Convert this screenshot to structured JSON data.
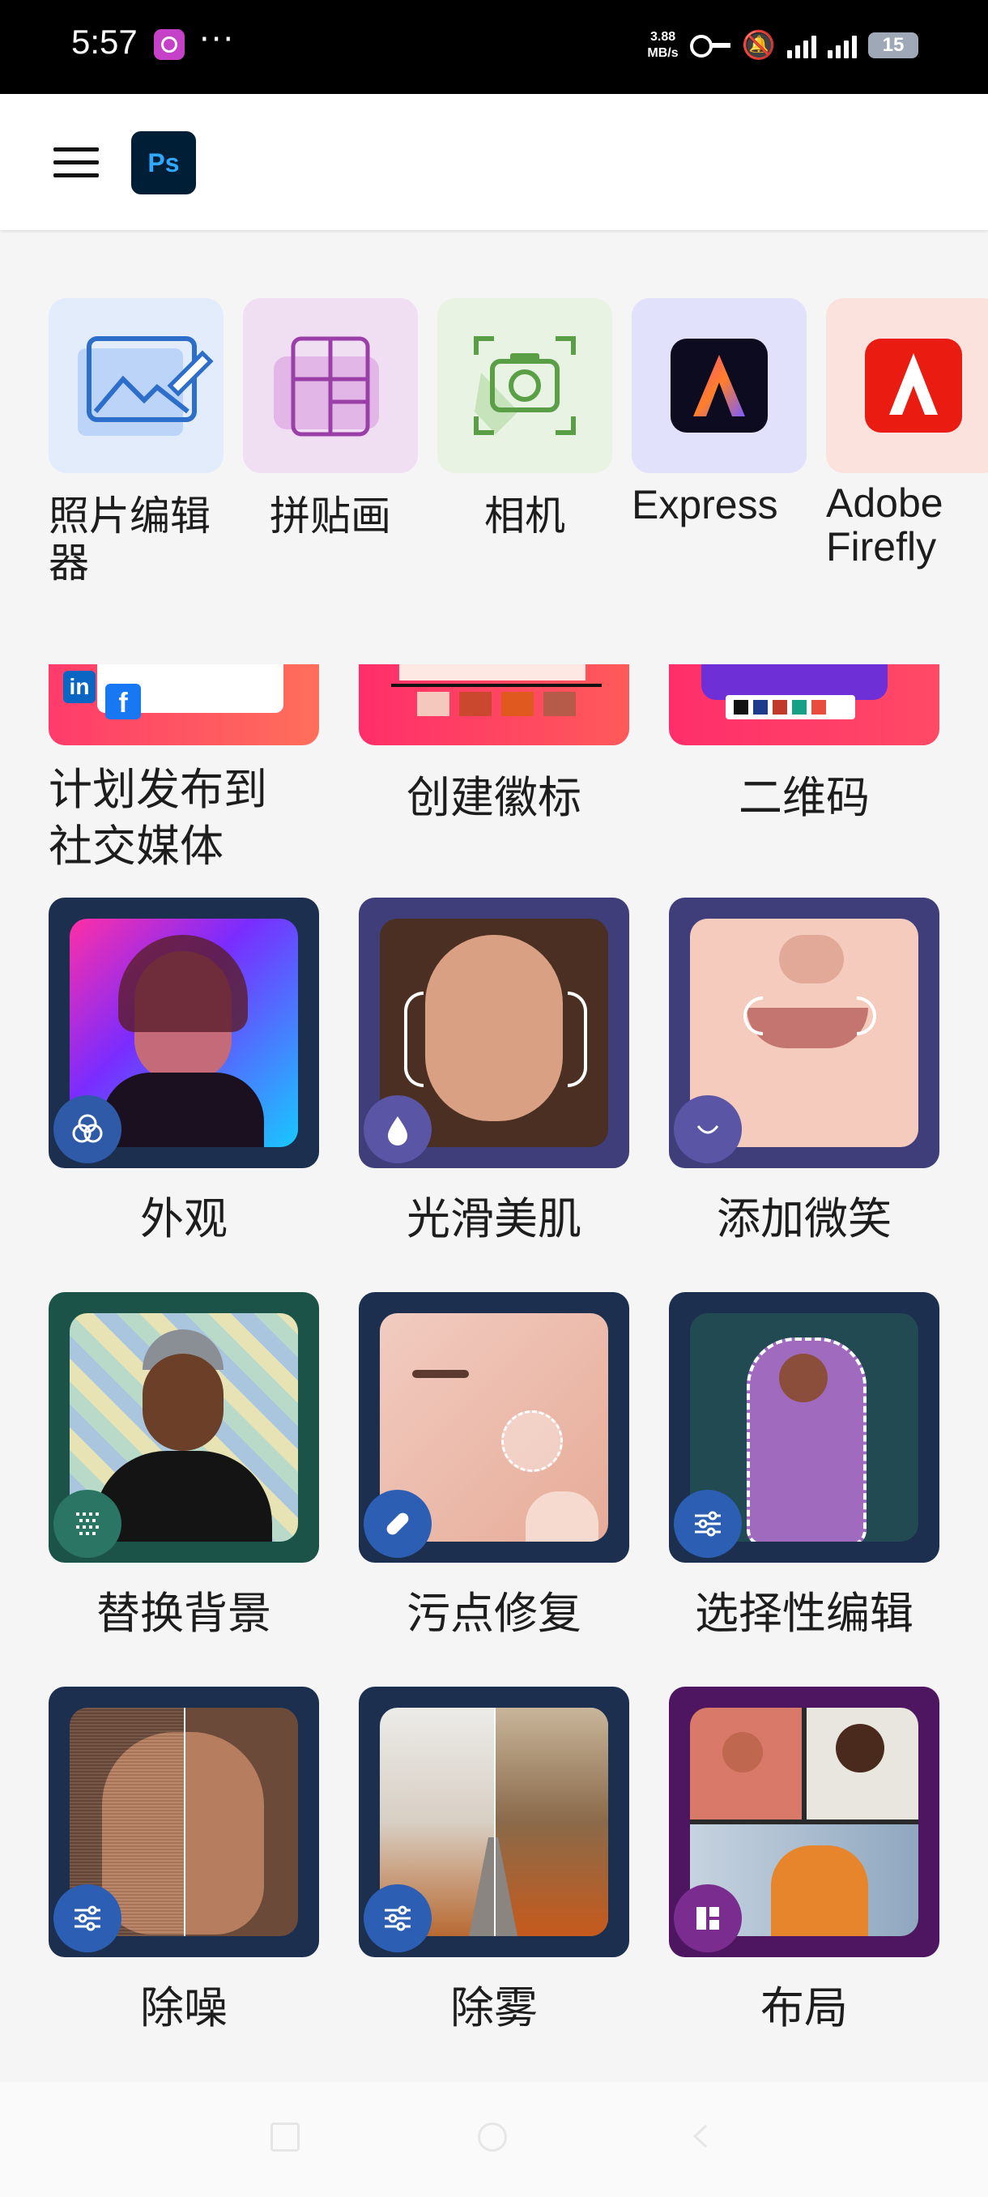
{
  "status_bar": {
    "time": "5:57",
    "more": "···",
    "speed_value": "3.88",
    "speed_unit": "MB/s",
    "battery": "15"
  },
  "app_bar": {
    "logo_text": "Ps",
    "accent": "#31a8ff"
  },
  "quick_actions": [
    {
      "label": "照片编辑器",
      "icon": "photo-edit-icon",
      "bg": "#e3ecfb"
    },
    {
      "label": "拼贴画",
      "icon": "collage-icon",
      "bg": "#f0def3"
    },
    {
      "label": "相机",
      "icon": "camera-icon",
      "bg": "#e8f3e3"
    },
    {
      "label": "Express",
      "icon": "adobe-express-icon",
      "bg": "#e1e1fb"
    },
    {
      "label": "Adobe Firefly",
      "icon": "adobe-firefly-icon",
      "bg": "#fbe2dc"
    }
  ],
  "features": [
    {
      "label": "计划发布到社交媒体",
      "icon": "social-media-icon"
    },
    {
      "label": "创建徽标",
      "icon": "logo-icon"
    },
    {
      "label": "二维码",
      "icon": "qr-code-icon"
    },
    {
      "label": "外观",
      "icon": "looks-icon"
    },
    {
      "label": "光滑美肌",
      "icon": "smooth-skin-icon"
    },
    {
      "label": "添加微笑",
      "icon": "smile-icon"
    },
    {
      "label": "替换背景",
      "icon": "background-icon"
    },
    {
      "label": "污点修复",
      "icon": "bandage-icon"
    },
    {
      "label": "选择性编辑",
      "icon": "adjust-sliders-icon"
    },
    {
      "label": "除噪",
      "icon": "adjust-sliders-icon"
    },
    {
      "label": "除雾",
      "icon": "adjust-sliders-icon"
    },
    {
      "label": "布局",
      "icon": "layout-icon"
    }
  ]
}
